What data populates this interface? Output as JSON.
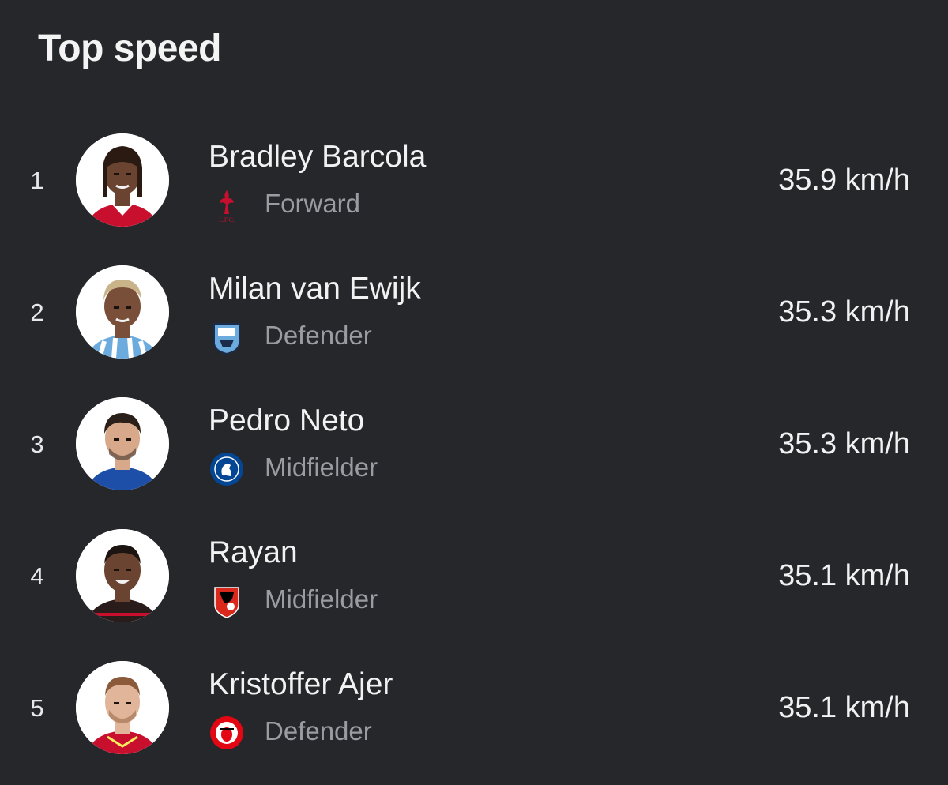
{
  "header": {
    "title": "Top speed"
  },
  "players": [
    {
      "rank": "1",
      "name": "Bradley Barcola",
      "position": "Forward",
      "speed": "35.9 km/h",
      "club_icon": "liverpool-crest-icon",
      "club_colors": {
        "primary": "#c8102e",
        "secondary": "#f6eb61"
      },
      "kit_color": "#c8102e",
      "skin": "#6b4431",
      "hair": "#2a1a12"
    },
    {
      "rank": "2",
      "name": "Milan van Ewijk",
      "position": "Defender",
      "speed": "35.3 km/h",
      "club_icon": "coventry-crest-icon",
      "club_colors": {
        "primary": "#6cabdd",
        "secondary": "#1a2b4c"
      },
      "kit_color": "#6cabdd",
      "skin": "#7a4f39",
      "hair": "#c9b48a"
    },
    {
      "rank": "3",
      "name": "Pedro Neto",
      "position": "Midfielder",
      "speed": "35.3 km/h",
      "club_icon": "chelsea-crest-icon",
      "club_colors": {
        "primary": "#034694",
        "secondary": "#ffffff"
      },
      "kit_color": "#1d4fa8",
      "skin": "#d7a98a",
      "hair": "#2b2019"
    },
    {
      "rank": "4",
      "name": "Rayan",
      "position": "Midfielder",
      "speed": "35.1 km/h",
      "club_icon": "bournemouth-crest-icon",
      "club_colors": {
        "primary": "#da291c",
        "secondary": "#000000"
      },
      "kit_color": "#2b1c1c",
      "skin": "#6b4431",
      "hair": "#1c1410"
    },
    {
      "rank": "5",
      "name": "Kristoffer Ajer",
      "position": "Defender",
      "speed": "35.1 km/h",
      "club_icon": "brentford-crest-icon",
      "club_colors": {
        "primary": "#e30613",
        "secondary": "#ffffff"
      },
      "kit_color": "#c8102e",
      "skin": "#e0b59a",
      "hair": "#8a5a3a"
    }
  ]
}
